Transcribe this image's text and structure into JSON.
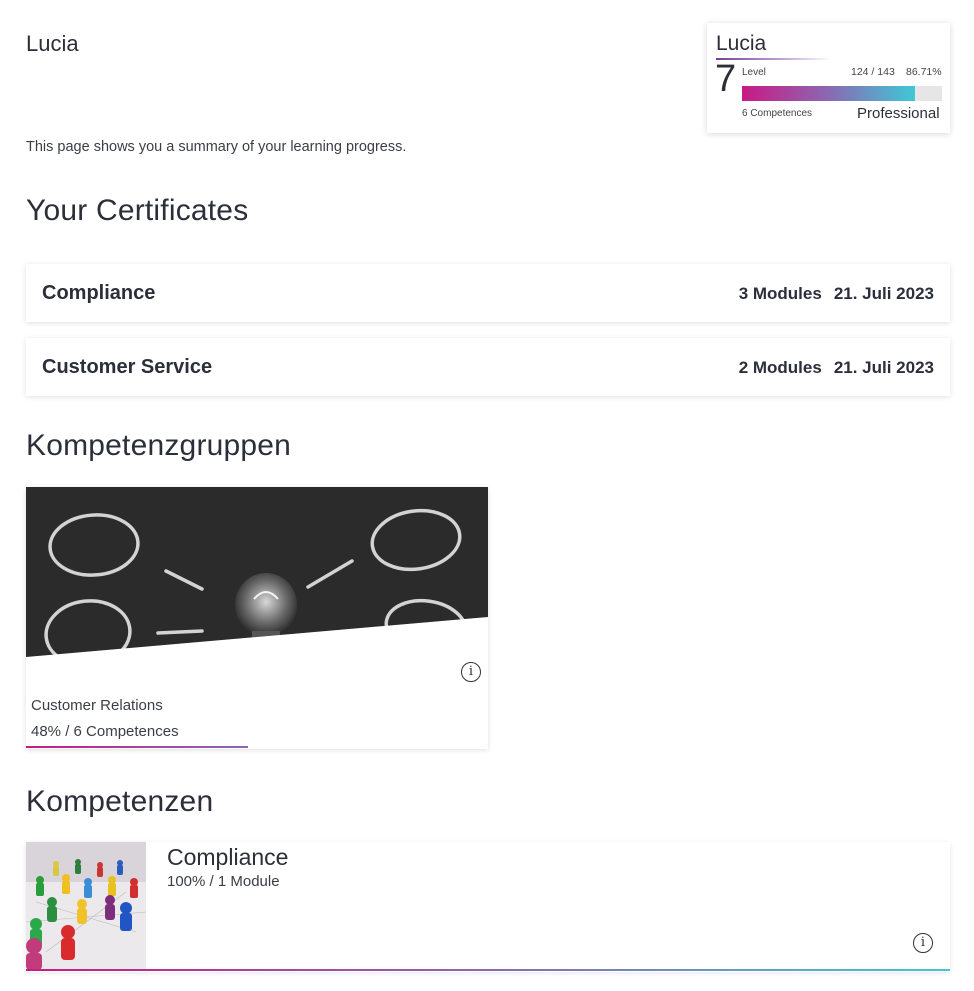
{
  "user": {
    "name": "Lucia"
  },
  "intro_text": "This page shows you a summary of your learning progress.",
  "level_card": {
    "name": "Lucia",
    "level_number": "7",
    "level_label": "Level",
    "points_text": "124 / 143",
    "percent_text": "86.71%",
    "progress_fraction": 0.8671,
    "competences_text": "6 Competences",
    "rank": "Professional"
  },
  "certificates_section": {
    "heading": "Your Certificates",
    "items": [
      {
        "title": "Compliance",
        "modules": "3 Modules",
        "date": "21. Juli 2023"
      },
      {
        "title": "Customer Service",
        "modules": "2 Modules",
        "date": "21. Juli 2023"
      }
    ]
  },
  "groups_section": {
    "heading": "Kompetenzgruppen",
    "items": [
      {
        "title": "Customer Relations",
        "subtitle": "48% / 6 Competences",
        "progress_fraction": 0.48,
        "icon": "info-icon"
      }
    ]
  },
  "competences_section": {
    "heading": "Kompetenzen",
    "items": [
      {
        "title": "Compliance",
        "subtitle": "100% / 1 Module",
        "progress_fraction": 1.0,
        "icon": "info-icon"
      }
    ]
  },
  "colors": {
    "gradient_start": "#c91a83",
    "gradient_mid": "#8b68b3",
    "gradient_end": "#3fc8d6"
  }
}
